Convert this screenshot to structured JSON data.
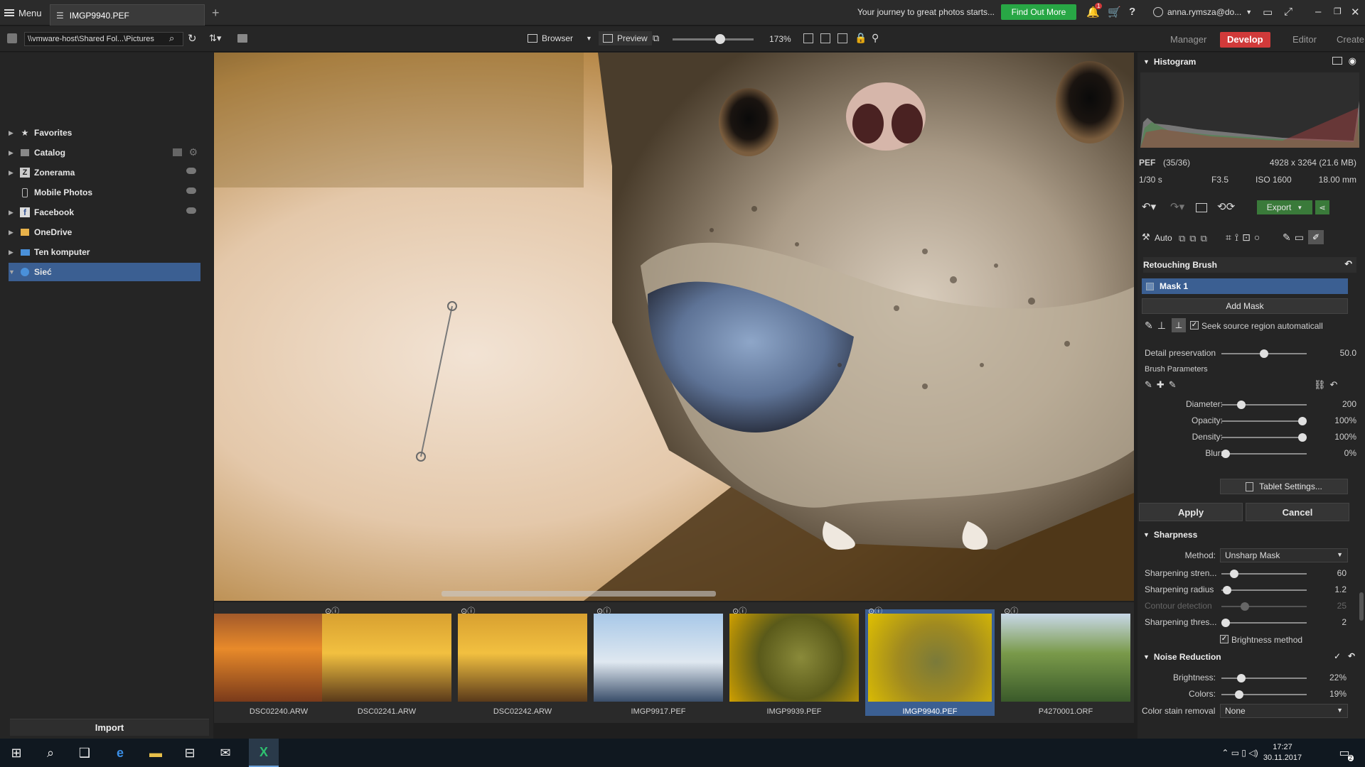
{
  "titlebar": {
    "menu_label": "Menu",
    "tab_title": "IMGP9940.PEF",
    "promo_text": "Your journey to great photos starts...",
    "cta_label": "Find Out More",
    "notification_count": "1",
    "user_name": "anna.rymsza@do..."
  },
  "toolbar": {
    "path": "\\\\vmware-host\\Shared Fol...\\Pictures",
    "browser_label": "Browser",
    "preview_label": "Preview",
    "zoom_level": "173%",
    "modules": [
      "Manager",
      "Develop",
      "Editor",
      "Create"
    ],
    "active_module": "Develop"
  },
  "navigator": {
    "items": [
      {
        "label": "Favorites",
        "icon": "star-icon"
      },
      {
        "label": "Catalog",
        "icon": "catalog-icon"
      },
      {
        "label": "Zonerama",
        "icon": "zonerama-icon"
      },
      {
        "label": "Mobile Photos",
        "icon": "phone-icon"
      },
      {
        "label": "Facebook",
        "icon": "facebook-icon"
      },
      {
        "label": "OneDrive",
        "icon": "onedrive-icon"
      },
      {
        "label": "Ten komputer",
        "icon": "computer-icon"
      },
      {
        "label": "Sieć",
        "icon": "network-icon"
      }
    ],
    "import_label": "Import"
  },
  "filmstrip": {
    "items": [
      {
        "name": "DSC02240.ARW"
      },
      {
        "name": "DSC02241.ARW"
      },
      {
        "name": "DSC02242.ARW"
      },
      {
        "name": "IMGP9917.PEF"
      },
      {
        "name": "IMGP9939.PEF"
      },
      {
        "name": "IMGP9940.PEF"
      },
      {
        "name": "P4270001.ORF"
      }
    ],
    "selected_index": 5
  },
  "info": {
    "format": "PEF",
    "index": "(35/36)",
    "dimensions": "4928 x 3264 (21.6 MB)",
    "shutter": "1/30 s",
    "aperture": "F3.5",
    "iso": "ISO 1600",
    "focal": "18.00 mm"
  },
  "histogram": {
    "title": "Histogram"
  },
  "actions": {
    "export_label": "Export",
    "auto_label": "Auto"
  },
  "retouch": {
    "title": "Retouching Brush",
    "mask_label": "Mask 1",
    "add_mask_label": "Add Mask",
    "seek_label": "Seek source region automaticall",
    "detail_label": "Detail preservation",
    "detail_value": "50.0",
    "detail_level": 0.5,
    "brush_params_label": "Brush Parameters",
    "params": [
      {
        "label": "Diameter:",
        "value": "200",
        "level": 0.2
      },
      {
        "label": "Opacity:",
        "value": "100%",
        "level": 1.0
      },
      {
        "label": "Density:",
        "value": "100%",
        "level": 1.0
      },
      {
        "label": "Blur:",
        "value": "0%",
        "level": 0.0
      }
    ],
    "tablet_label": "Tablet Settings...",
    "apply_label": "Apply",
    "cancel_label": "Cancel"
  },
  "sharpness": {
    "title": "Sharpness",
    "method_label": "Method:",
    "method_value": "Unsharp Mask",
    "params": [
      {
        "label": "Sharpening stren...",
        "value": "60",
        "level": 0.1
      },
      {
        "label": "Sharpening radius",
        "value": "1.2",
        "level": 0.02
      },
      {
        "label": "Contour detection",
        "value": "25",
        "level": 0.25
      },
      {
        "label": "Sharpening thres...",
        "value": "2",
        "level": 0.02
      }
    ],
    "brightness_method_label": "Brightness method"
  },
  "noise": {
    "title": "Noise Reduction",
    "params": [
      {
        "label": "Brightness:",
        "value": "22%",
        "level": 0.22
      },
      {
        "label": "Colors:",
        "value": "19%",
        "level": 0.19
      }
    ],
    "stain_label": "Color stain removal",
    "stain_value": "None"
  },
  "taskbar": {
    "time": "17:27",
    "date": "30.11.2017",
    "notifications_badge": "2"
  }
}
